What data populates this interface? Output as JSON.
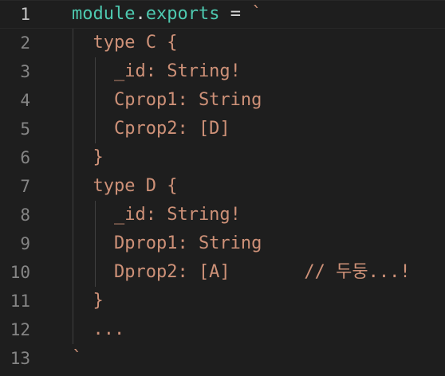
{
  "editor": {
    "lines": [
      {
        "num": "1",
        "parts": {
          "a": "module",
          "b": ".",
          "c": "exports",
          "d": " = ",
          "e": "`"
        }
      },
      {
        "num": "2",
        "text": "  type C {"
      },
      {
        "num": "3",
        "text": "    _id: String!"
      },
      {
        "num": "4",
        "text": "    Cprop1: String"
      },
      {
        "num": "5",
        "text": "    Cprop2: [D]"
      },
      {
        "num": "6",
        "text": "  }"
      },
      {
        "num": "7",
        "text": "  type D {"
      },
      {
        "num": "8",
        "text": "    _id: String!"
      },
      {
        "num": "9",
        "text": "    Dprop1: String"
      },
      {
        "num": "10",
        "text": "    Dprop2: [A]       // 두둥...!"
      },
      {
        "num": "11",
        "text": "  }"
      },
      {
        "num": "12",
        "text": "  ..."
      },
      {
        "num": "13",
        "text": "`"
      }
    ]
  },
  "colors": {
    "background": "#1e1e1e",
    "line_number": "#858585",
    "line_number_active": "#c6c6c6",
    "module_identifier": "#4ec9b0",
    "punctuation": "#d4d4d4",
    "template_string": "#ce9178"
  }
}
